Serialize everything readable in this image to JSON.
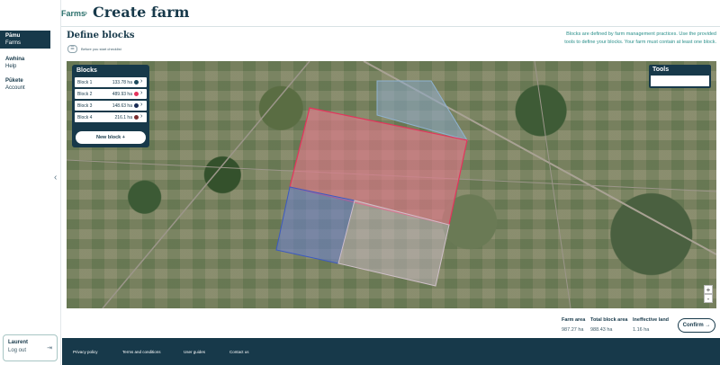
{
  "sidebar": {
    "items": [
      {
        "title": "Pāmu",
        "sub": "Farms"
      },
      {
        "title": "Awhina",
        "sub": "Help"
      },
      {
        "title": "Pūkete",
        "sub": "Account"
      }
    ],
    "collapse_glyph": "‹"
  },
  "user": {
    "name": "Laurent",
    "logout": "Log out",
    "icon": "logout-icon"
  },
  "header": {
    "breadcrumb": "Farms",
    "separator": "›",
    "title": "Create farm"
  },
  "section": {
    "title": "Define blocks",
    "checklist_label": "Before you start checklist",
    "info": "Blocks are defined by farm management practices. Use the provided tools to define your blocks. Your farm must contain at least one block."
  },
  "blocks_panel": {
    "title": "Blocks",
    "rows": [
      {
        "name": "Block 1",
        "area": "133.78 ha",
        "color": "#1d4a5c"
      },
      {
        "name": "Block 2",
        "area": "489.93 ha",
        "color": "#e4345c"
      },
      {
        "name": "Block 3",
        "area": "148.63 ha",
        "color": "#1b2c55"
      },
      {
        "name": "Block 4",
        "area": "216.1 ha",
        "color": "#7a2e2e"
      }
    ],
    "new_block": "New block  +"
  },
  "tools_panel": {
    "title": "Tools"
  },
  "map_controls": {
    "zoom_in": "+",
    "zoom_out": "-"
  },
  "stats": {
    "farm_area_label": "Farm area",
    "farm_area_value": "987.27 ha",
    "total_block_label": "Total block area",
    "total_block_value": "988.43 ha",
    "ineffective_label": "Ineffective land",
    "ineffective_value": "1.16 ha"
  },
  "confirm": "Confirm  →",
  "footer": {
    "links": [
      "Privacy policy",
      "Terms and conditions",
      "User guides",
      "Contact us"
    ]
  },
  "colors": {
    "primary": "#17394a",
    "accent": "#2a8f8a"
  }
}
